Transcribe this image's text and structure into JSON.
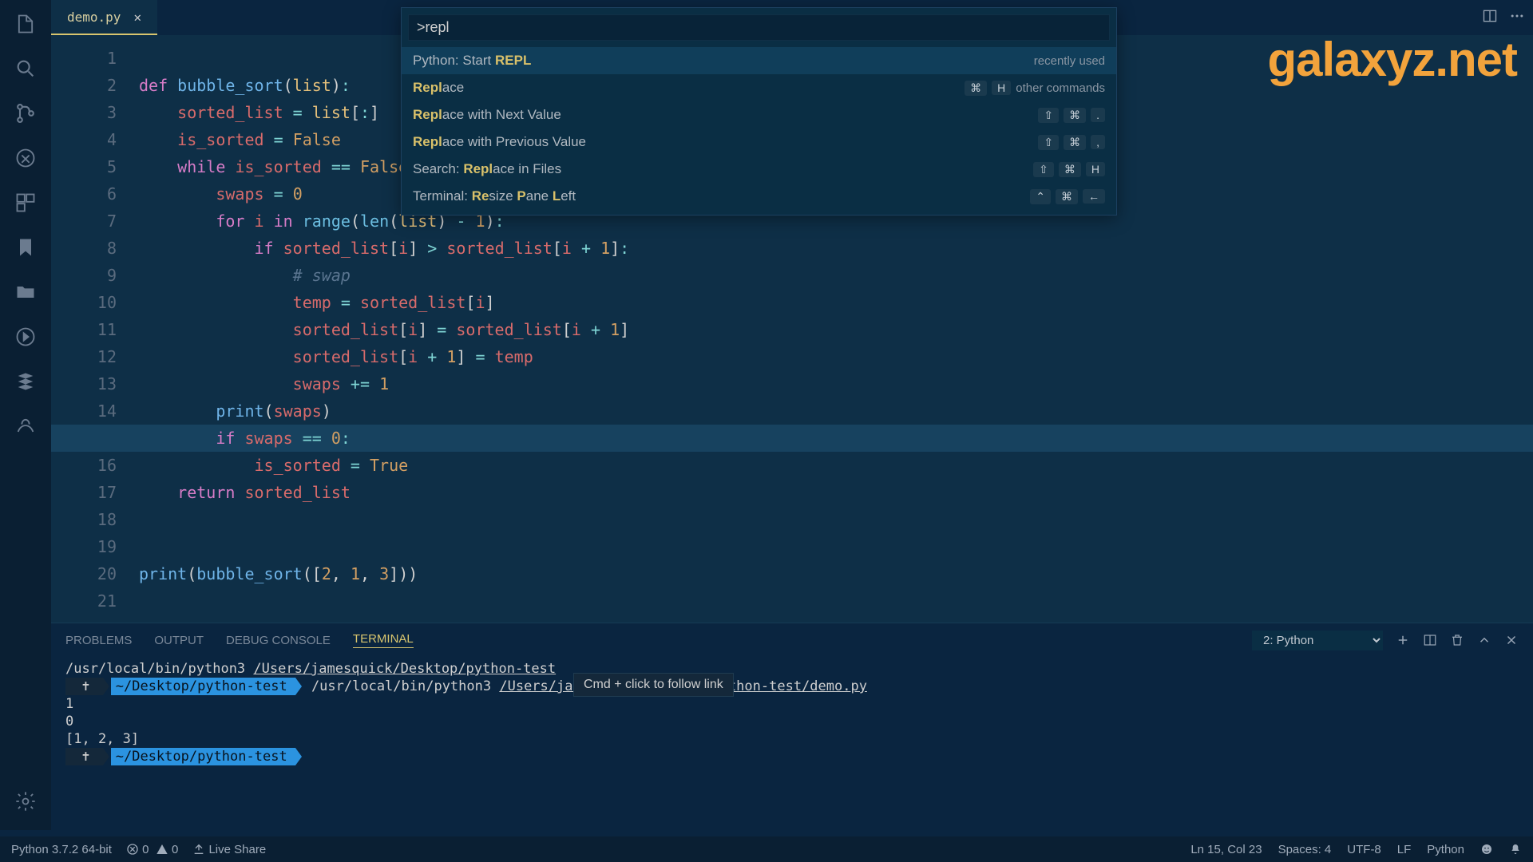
{
  "watermark": "galaxyz.net",
  "tab": {
    "filename": "demo.py"
  },
  "command_palette": {
    "input": ">repl",
    "items": [
      {
        "label_html": "Python: Start <span class='hl'>REPL</span>",
        "meta_text": "recently used",
        "keys": [],
        "selected": true
      },
      {
        "label_html": "<span class='hl'>Repl</span>ace",
        "meta_text": "other commands",
        "keys": [
          "⌘",
          "H"
        ]
      },
      {
        "label_html": "<span class='hl'>Repl</span>ace with Next Value",
        "meta_text": "",
        "keys": [
          "⇧",
          "⌘",
          "."
        ]
      },
      {
        "label_html": "<span class='hl'>Repl</span>ace with Previous Value",
        "meta_text": "",
        "keys": [
          "⇧",
          "⌘",
          ","
        ]
      },
      {
        "label_html": "Search: <span class='hl'>Repl</span>ace in Files",
        "meta_text": "",
        "keys": [
          "⇧",
          "⌘",
          "H"
        ]
      },
      {
        "label_html": "Terminal: <span class='hl'>Re</span>size <span class='hl'>P</span>ane <span class='hl'>L</span>eft",
        "meta_text": "",
        "keys": [
          "⌃",
          "⌘",
          "←"
        ]
      }
    ]
  },
  "code_lines": [
    "",
    "<span class='kw'>def</span> <span class='fn'>bubble_sort</span><span class='punc'>(</span><span class='param'>list</span><span class='punc'>)</span><span class='op'>:</span>",
    "    <span class='ident'>sorted_list</span> <span class='op'>=</span> <span class='param'>list</span><span class='punc'>[</span><span class='op'>:</span><span class='punc'>]</span>",
    "    <span class='ident'>is_sorted</span> <span class='op'>=</span> <span class='bool'>False</span>",
    "    <span class='kw'>while</span> <span class='ident'>is_sorted</span> <span class='op'>==</span> <span class='bool'>False</span><span class='op'>:</span>",
    "        <span class='ident'>swaps</span> <span class='op'>=</span> <span class='num'>0</span>",
    "        <span class='kw'>for</span> <span class='ident'>i</span> <span class='kw'>in</span> <span class='builtin'>range</span><span class='punc'>(</span><span class='builtin'>len</span><span class='punc'>(</span><span class='param'>list</span><span class='punc'>)</span> <span class='op'>-</span> <span class='num'>1</span><span class='punc'>)</span><span class='op'>:</span>",
    "            <span class='kw'>if</span> <span class='ident'>sorted_list</span><span class='punc'>[</span><span class='ident'>i</span><span class='punc'>]</span> <span class='op'>&gt;</span> <span class='ident'>sorted_list</span><span class='punc'>[</span><span class='ident'>i</span> <span class='op'>+</span> <span class='num'>1</span><span class='punc'>]</span><span class='op'>:</span>",
    "                <span class='cmt'># swap</span>",
    "                <span class='ident'>temp</span> <span class='op'>=</span> <span class='ident'>sorted_list</span><span class='punc'>[</span><span class='ident'>i</span><span class='punc'>]</span>",
    "                <span class='ident'>sorted_list</span><span class='punc'>[</span><span class='ident'>i</span><span class='punc'>]</span> <span class='op'>=</span> <span class='ident'>sorted_list</span><span class='punc'>[</span><span class='ident'>i</span> <span class='op'>+</span> <span class='num'>1</span><span class='punc'>]</span>",
    "                <span class='ident'>sorted_list</span><span class='punc'>[</span><span class='ident'>i</span> <span class='op'>+</span> <span class='num'>1</span><span class='punc'>]</span> <span class='op'>=</span> <span class='ident'>temp</span>",
    "                <span class='ident'>swaps</span> <span class='op'>+=</span> <span class='num'>1</span>",
    "        <span class='fn'>print</span><span class='punc'>(</span><span class='ident'>swaps</span><span class='punc'>)</span>",
    "        <span class='kw'>if</span> <span class='ident'>swaps</span> <span class='op'>==</span> <span class='num'>0</span><span class='op'>:</span>",
    "            <span class='ident'>is_sorted</span> <span class='op'>=</span> <span class='bool'>True</span>",
    "    <span class='kw'>return</span> <span class='ident'>sorted_list</span>",
    "",
    "",
    "<span class='fn'>print</span><span class='punc'>(</span><span class='fn'>bubble_sort</span><span class='punc'>(</span><span class='punc'>[</span><span class='num'>2</span><span class='punc'>,</span> <span class='num'>1</span><span class='punc'>,</span> <span class='num'>3</span><span class='punc'>]</span><span class='punc'>)</span><span class='punc'>)</span>",
    ""
  ],
  "current_line": 15,
  "panel": {
    "tabs": [
      "PROBLEMS",
      "OUTPUT",
      "DEBUG CONSOLE",
      "TERMINAL"
    ],
    "active_tab": "TERMINAL",
    "select": "2: Python",
    "terminal": {
      "line1_cmd": "/usr/local/bin/python3",
      "line1_path": "/Users/jamesquick/Desktop/python-test",
      "prompt_symbol": "✝",
      "prompt_path": "~/Desktop/python-test",
      "line2_cmd": "/usr/local/bin/python3",
      "line2_path": "/Users/jamesquick/Desktop/python-test/demo.py",
      "out1": "1",
      "out2": "0",
      "out3": "[1, 2, 3]",
      "tooltip": "Cmd + click to follow link"
    }
  },
  "statusbar": {
    "python": "Python 3.7.2 64-bit",
    "err": "0",
    "warn": "0",
    "liveshare": "Live Share",
    "pos": "Ln 15, Col 23",
    "spaces": "Spaces: 4",
    "encoding": "UTF-8",
    "eol": "LF",
    "lang": "Python"
  }
}
